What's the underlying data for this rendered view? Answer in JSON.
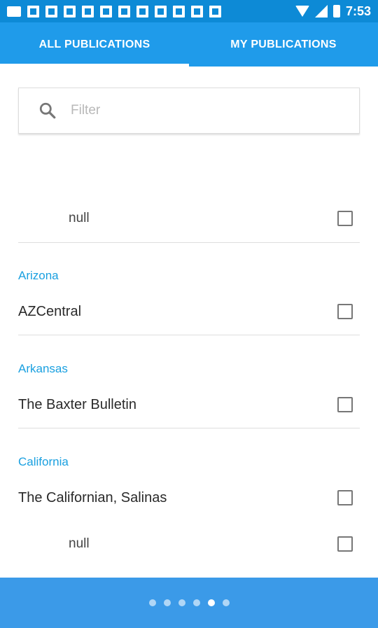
{
  "status": {
    "time": "7:53"
  },
  "tabs": [
    {
      "label": "ALL PUBLICATIONS",
      "active": true
    },
    {
      "label": "MY PUBLICATIONS",
      "active": false
    }
  ],
  "filter": {
    "placeholder": "Filter",
    "value": ""
  },
  "list": {
    "items": [
      {
        "name": "null",
        "checked": false
      },
      {
        "section": "Arizona"
      },
      {
        "name": "AZCentral",
        "checked": false
      },
      {
        "section": "Arkansas"
      },
      {
        "name": "The Baxter Bulletin",
        "checked": false
      },
      {
        "section": "California"
      },
      {
        "name": "The Californian, Salinas",
        "checked": false
      },
      {
        "name": "null",
        "checked": false
      }
    ]
  },
  "pager": {
    "count": 6,
    "active_index": 4
  },
  "colors": {
    "header": "#1f9bea",
    "accent": "#1aa0e0",
    "footer": "#3b9ae8"
  }
}
